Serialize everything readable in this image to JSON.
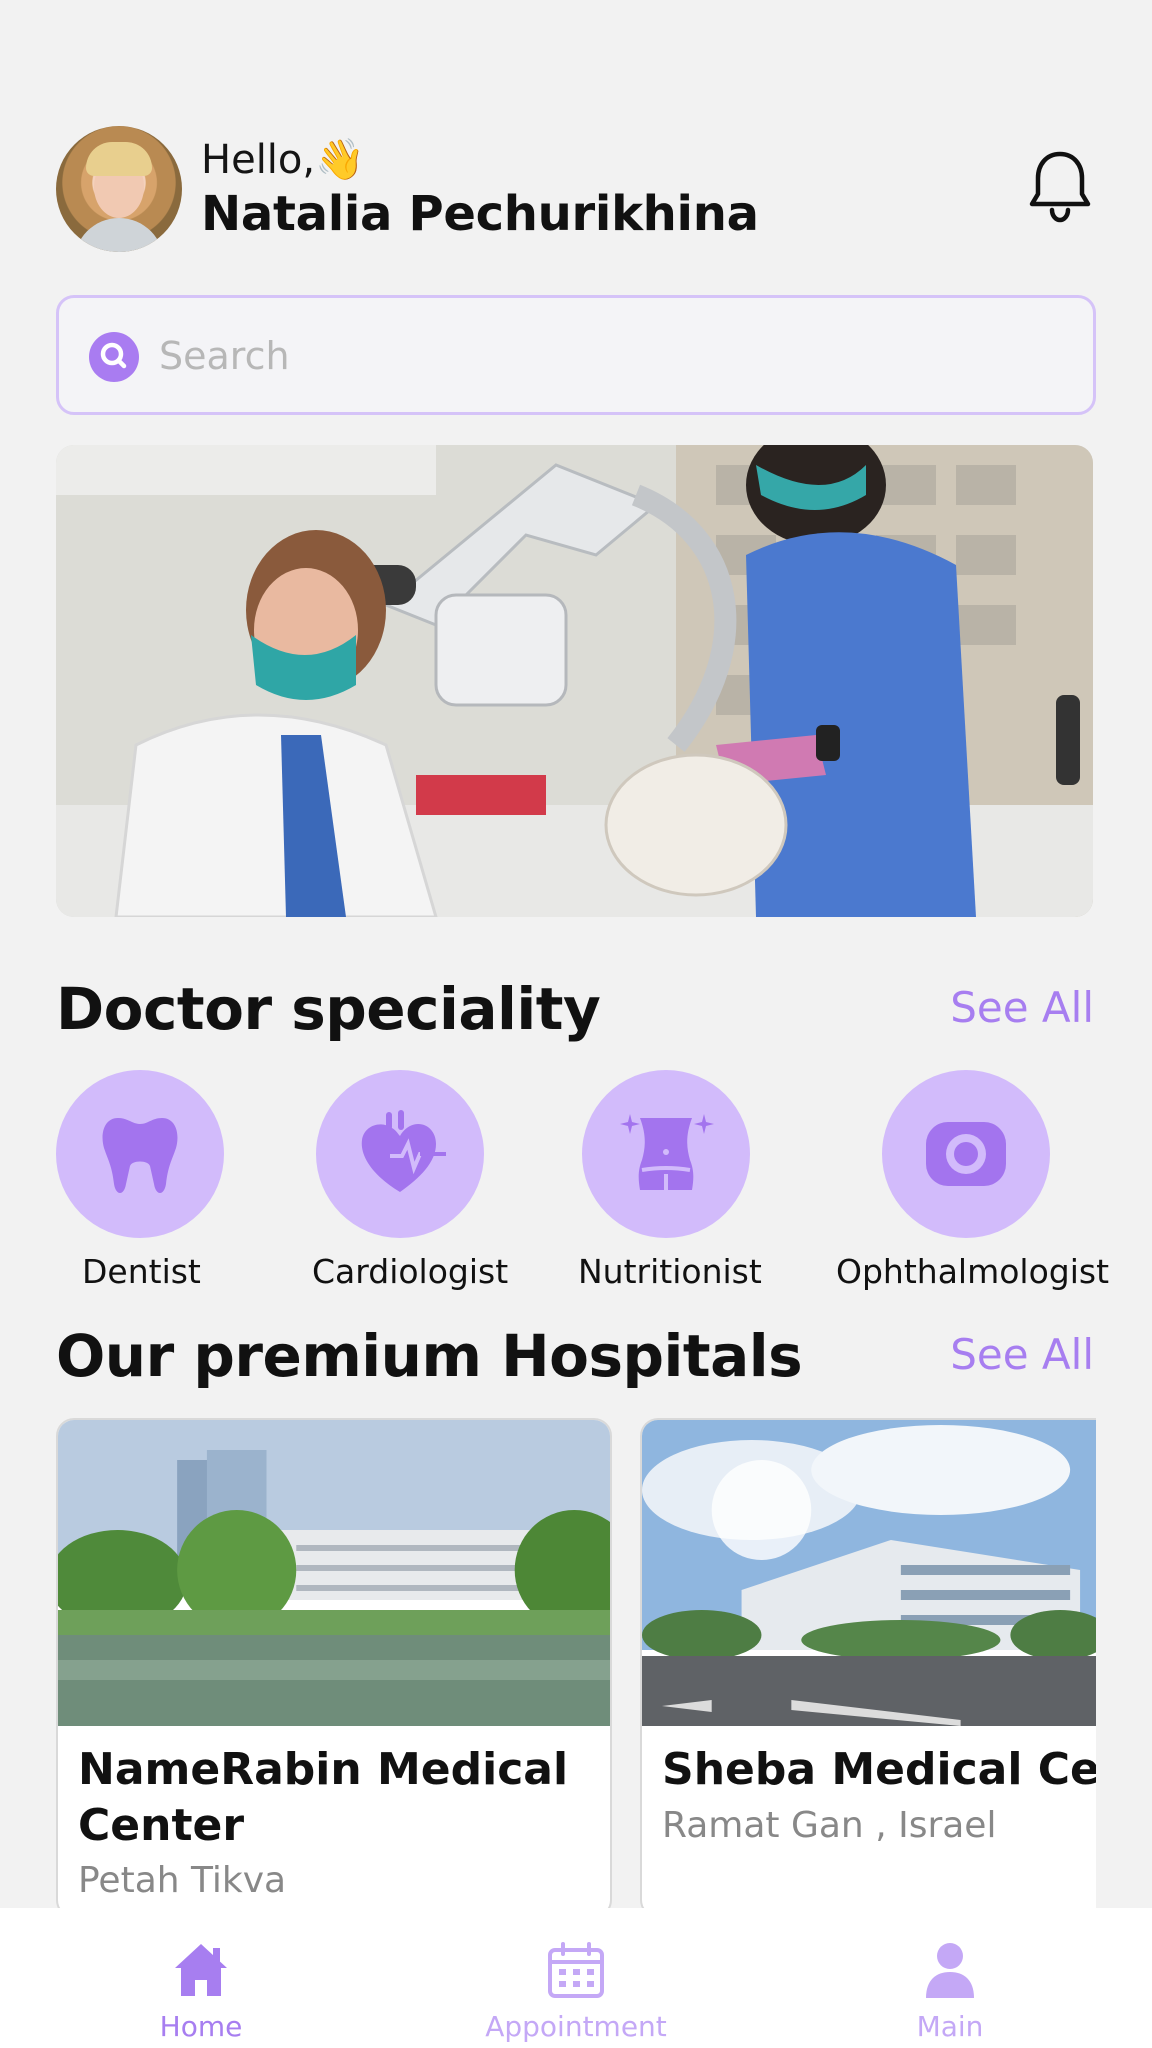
{
  "header": {
    "greeting": "Hello,",
    "wave_emoji": "👋",
    "user_name": "Natalia Pechurikhina",
    "avatar_icon": "avatar",
    "notification_icon": "bell-icon"
  },
  "search": {
    "placeholder": "Search",
    "value": "",
    "icon": "search-icon"
  },
  "banner": {
    "image_subject": "dentist-with-microscope"
  },
  "specialities": {
    "title": "Doctor speciality",
    "see_all": "See All",
    "items": [
      {
        "label": "Dentist",
        "icon": "tooth-icon"
      },
      {
        "label": "Cardiologist",
        "icon": "heart-icon"
      },
      {
        "label": "Nutritionist",
        "icon": "body-icon"
      },
      {
        "label": "Ophthalmologist",
        "icon": "eye-icon"
      }
    ]
  },
  "hospitals": {
    "title": "Our premium Hospitals",
    "see_all": "See All",
    "items": [
      {
        "name_line1": "NameRabin Medical",
        "name_line2": "Center",
        "location": "Petah Tikva"
      },
      {
        "name_line1": "Sheba Medical Cen",
        "location": "Ramat Gan , Israel"
      }
    ]
  },
  "bottom_nav": {
    "items": [
      {
        "label": "Home",
        "icon": "home-icon",
        "active": true
      },
      {
        "label": "Appointment",
        "icon": "calendar-icon",
        "active": false
      },
      {
        "label": "Main",
        "icon": "user-icon",
        "active": false
      }
    ]
  },
  "colors": {
    "accent": "#a77ef0",
    "accent_light": "#d2bbfb",
    "background": "#f2f2f2"
  }
}
